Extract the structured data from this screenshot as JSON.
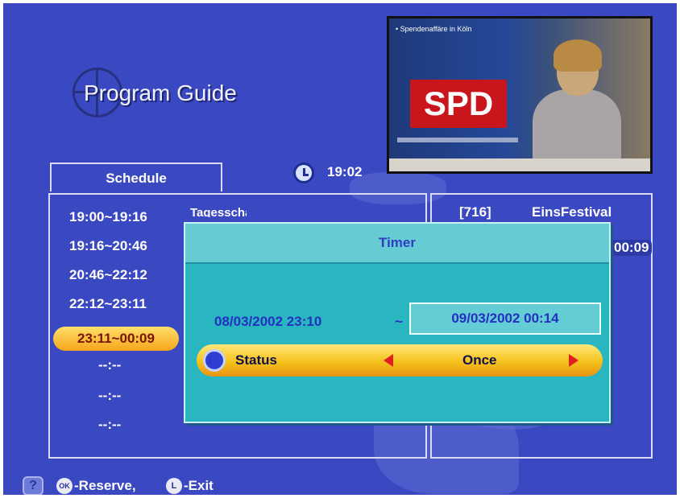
{
  "header": {
    "title": "Program Guide"
  },
  "tabs": {
    "schedule_label": "Schedule"
  },
  "clock": {
    "time": "19:02"
  },
  "schedule": {
    "times": [
      "19:00~19:16",
      "19:16~20:46",
      "20:46~22:12",
      "22:12~23:11",
      "23:11~00:09",
      "--:--",
      "--:--",
      "--:--"
    ],
    "selected_index": 4,
    "program_partial": "Tagesschau"
  },
  "channel": {
    "number": "[716]",
    "name": "EinsFestival",
    "time": "00:09"
  },
  "pip": {
    "caption": "• Spendenaffäre in Köln",
    "logo_text": "SPD"
  },
  "timer": {
    "title": "Timer",
    "start": "08/03/2002 23:10",
    "separator": "~",
    "end": "09/03/2002 00:14",
    "status_label": "Status",
    "status_value": "Once"
  },
  "footer": {
    "help_glyph": "?",
    "ok_icon_label": "OK",
    "ok_text": "-Reserve,",
    "exit_icon_label": "L",
    "exit_text": "-Exit"
  },
  "colors": {
    "background": "#3a48c2",
    "dialog": "#29b6c1",
    "selection": "#f5a51a",
    "arrows": "#e02020"
  }
}
